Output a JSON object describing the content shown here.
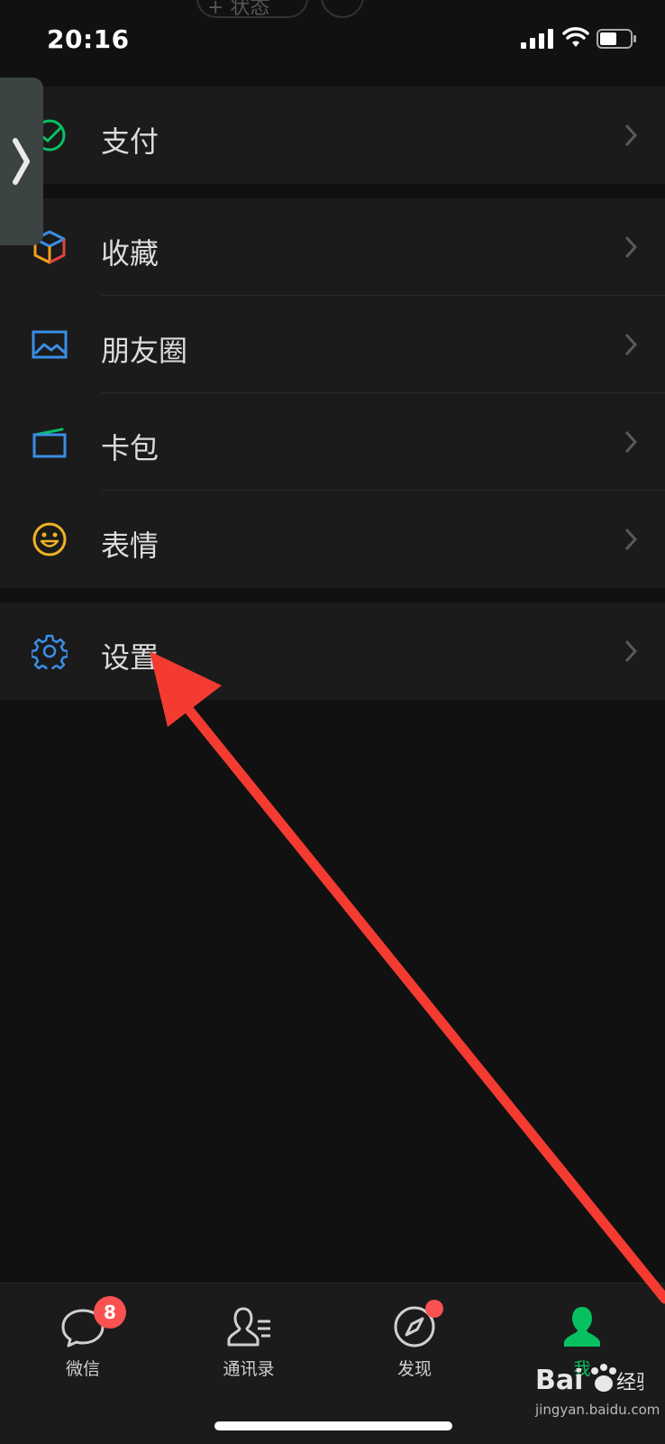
{
  "status_bar": {
    "time": "20:16",
    "top_pill_text": "+ 状态",
    "signal_icon": "cellular-signal-icon",
    "wifi_icon": "wifi-icon",
    "battery_icon": "battery-icon"
  },
  "menu_groups": [
    {
      "items": [
        {
          "label": "支付",
          "icon": "payment-check-icon",
          "icon_color": "#07c160"
        }
      ]
    },
    {
      "items": [
        {
          "label": "收藏",
          "icon": "favorites-cube-icon",
          "icon_color": "#f0a020"
        },
        {
          "label": "朋友圈",
          "icon": "moments-image-icon",
          "icon_color": "#3a8ee6"
        },
        {
          "label": "卡包",
          "icon": "card-wallet-icon",
          "icon_color": "#3a8ee6"
        },
        {
          "label": "表情",
          "icon": "sticker-smile-icon",
          "icon_color": "#f0b323"
        }
      ]
    },
    {
      "items": [
        {
          "label": "设置",
          "icon": "settings-gear-icon",
          "icon_color": "#3a8ee6"
        }
      ]
    }
  ],
  "tab_bar": {
    "tabs": [
      {
        "label": "微信",
        "icon": "chat-bubble-icon",
        "badge": "8",
        "active": false
      },
      {
        "label": "通讯录",
        "icon": "contacts-icon",
        "active": false
      },
      {
        "label": "发现",
        "icon": "discover-compass-icon",
        "dot": true,
        "active": false
      },
      {
        "label": "我",
        "icon": "me-person-icon",
        "active": true
      }
    ],
    "active_color": "#07c160",
    "badge_color": "#fa5151"
  },
  "watermark": {
    "brand": "Bai du 经验",
    "url": "jingyan.baidu.com"
  },
  "annotation": {
    "type": "red-arrow",
    "color": "#f33b32",
    "points_to": "设置"
  }
}
